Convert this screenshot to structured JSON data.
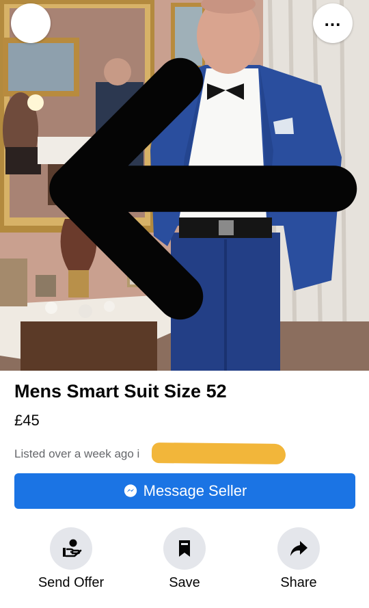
{
  "listing": {
    "title": "Mens Smart Suit Size 52",
    "price": "£45",
    "listed_text": "Listed over a week ago i"
  },
  "header": {
    "back_icon": "arrow-left-icon",
    "more_label": "..."
  },
  "buttons": {
    "message_seller": "Message Seller"
  },
  "actions": [
    {
      "label": "Send Offer",
      "icon": "send-offer-icon"
    },
    {
      "label": "Save",
      "icon": "bookmark-icon"
    },
    {
      "label": "Share",
      "icon": "share-arrow-icon"
    }
  ],
  "colors": {
    "primary_button": "#1b74e4",
    "action_circle": "#e4e6eb",
    "secondary_text": "#65676b",
    "redaction_marker": "#f2b63a"
  }
}
